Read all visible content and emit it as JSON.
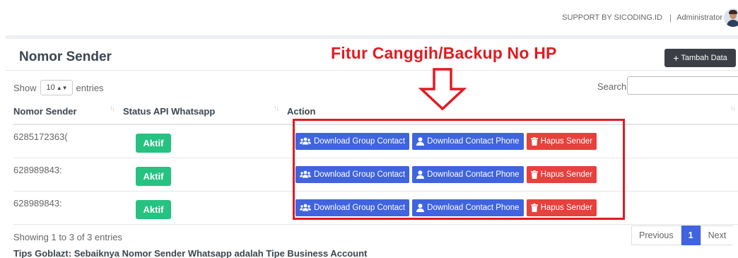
{
  "topbar": {
    "support": "SUPPORT BY SICODING.ID",
    "separator": "|",
    "user": "Administrator"
  },
  "panel": {
    "title": "Nomor Sender",
    "add_button": "Tambah Data",
    "add_icon": "plus-icon"
  },
  "annotation": {
    "text": "Fitur Canggih/Backup  No HP",
    "color": "#e11b22"
  },
  "table_controls": {
    "show_label": "Show",
    "entries_value": "10",
    "entries_label": "entries",
    "search_label": "Search:"
  },
  "table": {
    "headers": [
      "Nomor Sender",
      "Status API Whatsapp",
      "Action"
    ],
    "rows": [
      {
        "number": "6285172363(",
        "status": "Aktif"
      },
      {
        "number": "628989843:",
        "status": "Aktif"
      },
      {
        "number": "628989843:",
        "status": "Aktif"
      }
    ],
    "actions": {
      "group_contact": "Download Group Contact",
      "contact_phone": "Download Contact Phone",
      "delete": "Hapus Sender"
    }
  },
  "footer": {
    "info": "Showing 1 to 3 of 3 entries",
    "pagination": {
      "previous": "Previous",
      "current": "1",
      "next": "Next"
    },
    "tips": "Tips Goblazt: Sebaiknya Nomor Sender Whatsapp adalah Tipe Business Account"
  },
  "colors": {
    "primary": "#4064df",
    "danger": "#e7403d",
    "success": "#26c281",
    "dark": "#3b3f45"
  }
}
